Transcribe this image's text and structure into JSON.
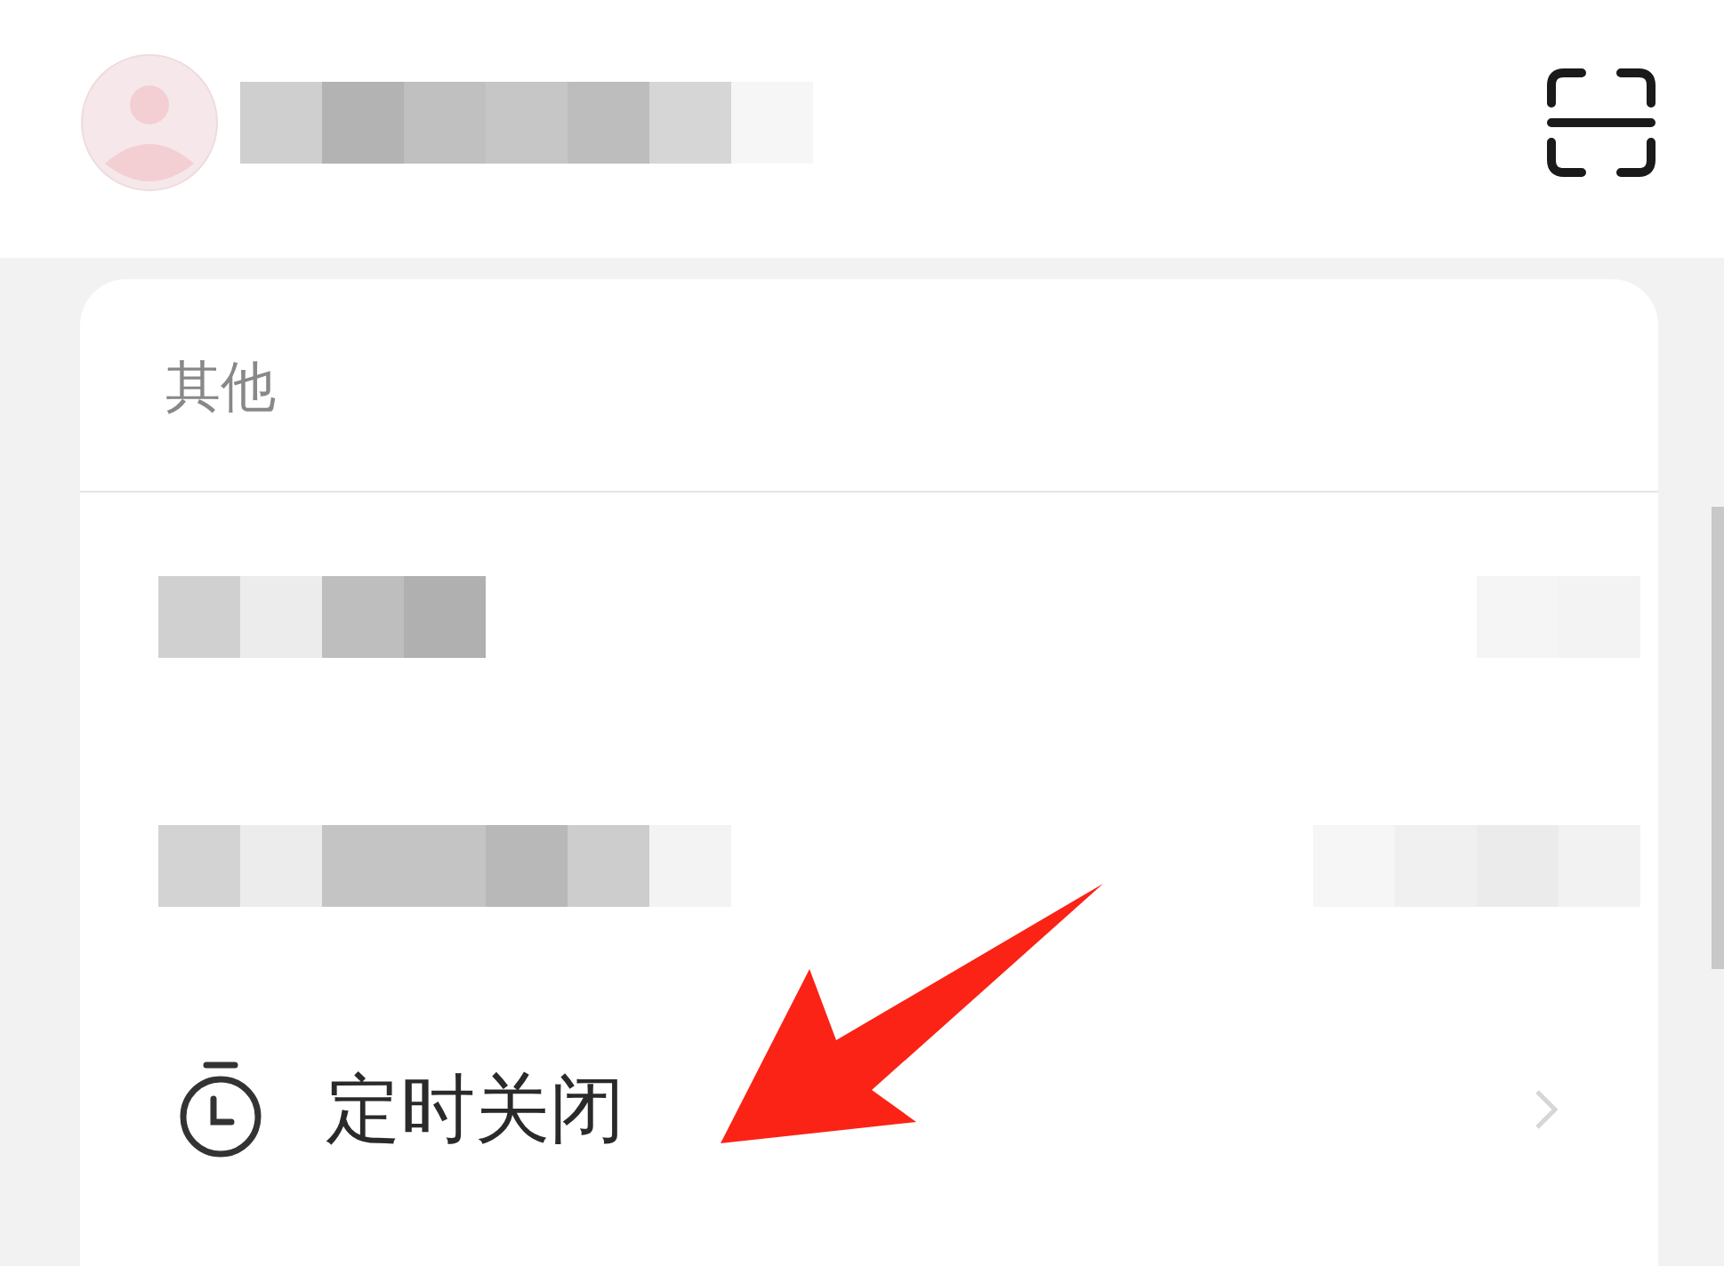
{
  "section": {
    "title": "其他"
  },
  "menu_items": [
    {
      "label": "定时关闭"
    }
  ]
}
